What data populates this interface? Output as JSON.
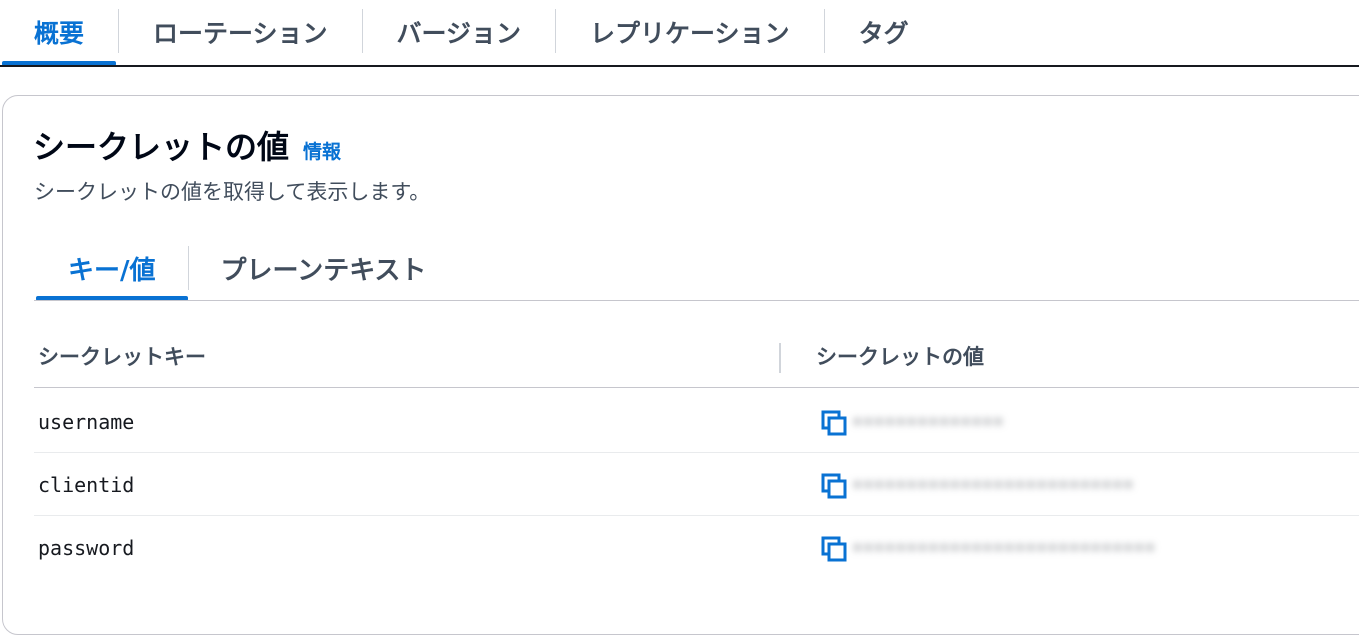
{
  "top_tabs": [
    {
      "label": "概要",
      "active": true
    },
    {
      "label": "ローテーション",
      "active": false
    },
    {
      "label": "バージョン",
      "active": false
    },
    {
      "label": "レプリケーション",
      "active": false
    },
    {
      "label": "タグ",
      "active": false
    }
  ],
  "panel": {
    "title": "シークレットの値",
    "info_link": "情報",
    "description": "シークレットの値を取得して表示します。"
  },
  "inner_tabs": [
    {
      "label": "キー/値",
      "active": true
    },
    {
      "label": "プレーンテキスト",
      "active": false
    }
  ],
  "table": {
    "headers": {
      "key": "シークレットキー",
      "value": "シークレットの値"
    },
    "rows": [
      {
        "key": "username",
        "value_masked": "••••••••••••••"
      },
      {
        "key": "clientid",
        "value_masked": "••••••••••••••••••••••••••"
      },
      {
        "key": "password",
        "value_masked": "••••••••••••••••••••••••••••"
      }
    ]
  },
  "colors": {
    "accent": "#0972d3",
    "text": "#16191f",
    "muted": "#414d5c",
    "border": "#c6c6cd"
  },
  "icons": {
    "copy": "copy-icon"
  }
}
